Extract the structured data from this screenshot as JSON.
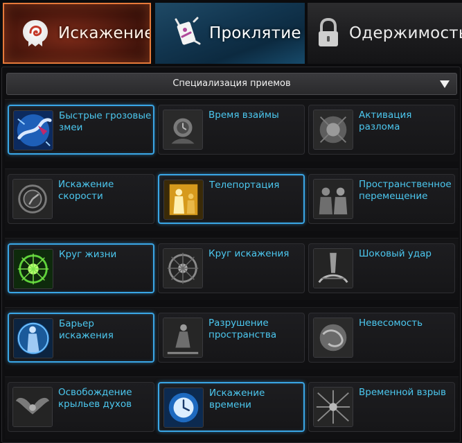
{
  "tabs": [
    {
      "label": "Искажение",
      "icon": "distortion-icon",
      "active": true
    },
    {
      "label": "Проклятие",
      "icon": "curse-icon",
      "active": false
    },
    {
      "label": "Одержимость",
      "icon": "lock-icon",
      "active": false
    }
  ],
  "dropdown": {
    "label": "Специализация приемов",
    "icon": "dropdown-arrow-icon"
  },
  "colors": {
    "skill_name": "#4cc8f0",
    "selected_border": "#3aa6e6",
    "active_tab_border": "#e77a3a"
  },
  "rows": [
    {
      "skills": [
        {
          "name": "Быстрые грозовые змеи",
          "icon": "thunder-serpent-icon",
          "selected": true
        },
        {
          "name": "Время взаймы",
          "icon": "borrowed-time-icon",
          "selected": false
        },
        {
          "name": "Активация разлома",
          "icon": "rift-activation-icon",
          "selected": false
        }
      ]
    },
    {
      "skills": [
        {
          "name": "Искажение скорости",
          "icon": "speed-distortion-icon",
          "selected": false
        },
        {
          "name": "Телепортация",
          "icon": "teleport-icon",
          "selected": true
        },
        {
          "name": "Пространственное перемещение",
          "icon": "spatial-shift-icon",
          "selected": false
        }
      ]
    },
    {
      "skills": [
        {
          "name": "Круг жизни",
          "icon": "circle-of-life-icon",
          "selected": true
        },
        {
          "name": "Круг искажения",
          "icon": "distortion-circle-icon",
          "selected": false
        },
        {
          "name": "Шоковый удар",
          "icon": "shock-strike-icon",
          "selected": false
        }
      ]
    },
    {
      "skills": [
        {
          "name": "Барьер искажения",
          "icon": "distortion-barrier-icon",
          "selected": true
        },
        {
          "name": "Разрушение пространства",
          "icon": "space-destruction-icon",
          "selected": false
        },
        {
          "name": "Невесомость",
          "icon": "weightlessness-icon",
          "selected": false
        }
      ]
    },
    {
      "skills": [
        {
          "name": "Освобождение крыльев духов",
          "icon": "spirit-wings-icon",
          "selected": false
        },
        {
          "name": "Искажение времени",
          "icon": "time-distortion-icon",
          "selected": true
        },
        {
          "name": "Временной взрыв",
          "icon": "time-burst-icon",
          "selected": false
        }
      ]
    }
  ]
}
